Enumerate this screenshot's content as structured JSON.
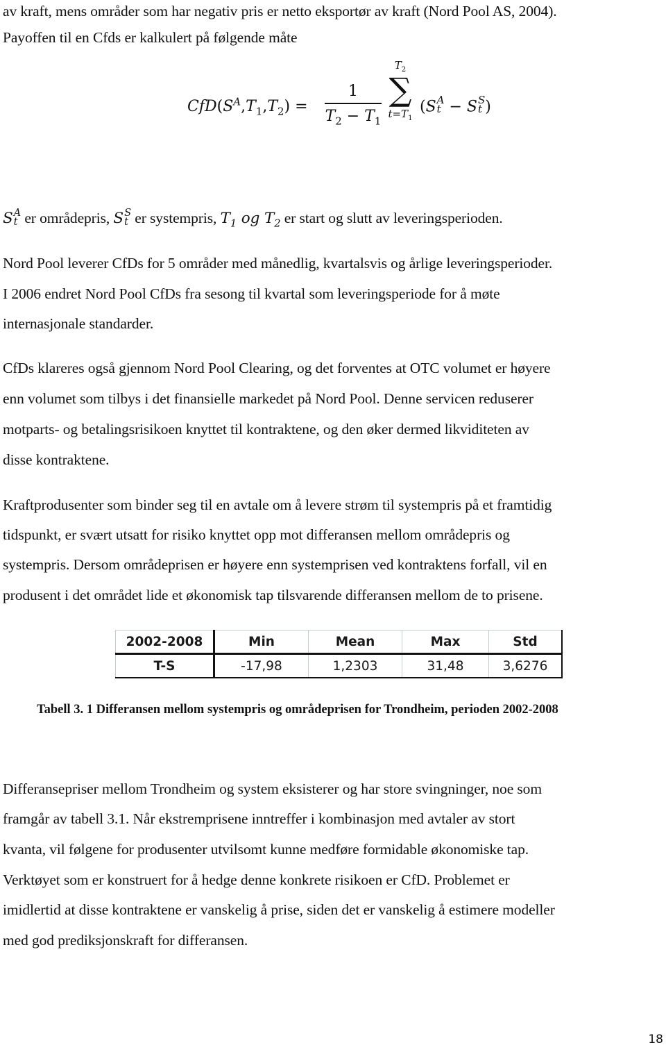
{
  "document": {
    "paragraph_intro": {
      "lines": [
        "av kraft, mens områder som har negativ pris er netto eksportør av kraft (Nord Pool AS, 2004).",
        "Payoffen til en Cfds er kalkulert på følgende måte"
      ]
    },
    "formula": {
      "lhs_name": "CfD",
      "lhs_args_open": "(",
      "lhs_S": "S",
      "lhs_S_sup": "A",
      "lhs_T1": "T",
      "lhs_T1_sub": "1",
      "lhs_T2": "T",
      "lhs_T2_sub": "2",
      "lhs_close_eq": ") =",
      "comma": ",",
      "frac_numerator": "1",
      "frac_den_T2": "T",
      "frac_den_T2_sub": "2",
      "frac_den_minus": " − ",
      "frac_den_T1": "T",
      "frac_den_T1_sub": "1",
      "sum_symbol": "∑",
      "sum_upper": "T",
      "sum_upper_sub": "2",
      "sum_lower": "t=T",
      "sum_lower_sub": "1",
      "rhs_open": "(",
      "rhs_SA": "S",
      "rhs_SA_sup": "A",
      "rhs_SA_sub": "t",
      "rhs_minus": " − ",
      "rhs_SS": "S",
      "rhs_SS_sup": "S",
      "rhs_SS_sub": "t",
      "rhs_close": ")"
    },
    "definitions": {
      "sym1": "S",
      "sym1_sup": "A",
      "sym1_sub": "t",
      "text1": " er områdepris, ",
      "sym2": "S",
      "sym2_sup": "S",
      "sym2_sub": "t",
      "text2": " er systempris, ",
      "sym3": "T",
      "sym3_sub": "1",
      "og": " og ",
      "sym4": "T",
      "sym4_sub": "2",
      "text3": " er start og slutt av leveringsperioden."
    },
    "paragraph_nordpool": {
      "lines": [
        "Nord Pool leverer CfDs for 5 områder med månedlig, kvartalsvis og årlige leveringsperioder.",
        "I 2006 endret Nord Pool CfDs fra sesong til kvartal som leveringsperiode for å møte",
        "internasjonale standarder."
      ]
    },
    "paragraph_clearing": {
      "lines": [
        "CfDs  klareres også gjennom Nord Pool Clearing, og det forventes at OTC volumet er høyere",
        "enn volumet som tilbys i det finansielle markedet på Nord Pool. Denne servicen reduserer",
        "motparts- og betalingsrisikoen knyttet til kontraktene, og den øker dermed likviditeten av",
        "disse kontraktene."
      ]
    },
    "paragraph_producers": {
      "lines": [
        "Kraftprodusenter som binder seg til en avtale om å levere strøm til systempris på et framtidig",
        "tidspunkt, er svært utsatt for risiko knyttet opp mot differansen mellom områdepris og",
        "systempris. Dersom områdeprisen er høyere enn systemprisen ved kontraktens forfall, vil en",
        "produsent i det området lide et økonomisk tap tilsvarende differansen mellom de to prisene."
      ]
    },
    "table": {
      "headers": [
        "2002-2008",
        "Min",
        "Mean",
        "Max",
        "Std"
      ],
      "rows": [
        [
          "T-S",
          "-17,98",
          "1,2303",
          "31,48",
          "3,6276"
        ]
      ]
    },
    "caption": "Tabell 3. 1 Differansen mellom systempris og områdeprisen for Trondheim, perioden 2002-2008",
    "paragraph_differences": {
      "lines": [
        "Differansepriser mellom Trondheim og system eksisterer og har store svingninger, noe som",
        "framgår av tabell 3.1. Når ekstremprisene inntreffer i kombinasjon med avtaler av stort",
        "kvanta, vil følgene for produsenter utvilsomt kunne medføre formidable økonomiske tap.",
        "Verktøyet som er konstruert for å hedge denne konkrete risikoen er CfD. Problemet er",
        "imidlertid at disse kontraktene er vanskelig å prise, siden det er vanskelig å estimere modeller",
        "med god prediksjonskraft for differansen."
      ]
    },
    "page_number": "18"
  }
}
